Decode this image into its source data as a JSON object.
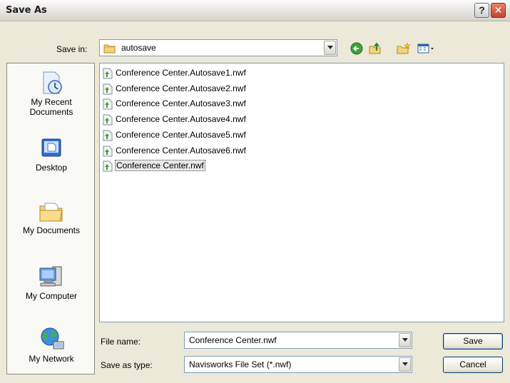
{
  "window": {
    "title": "Save As",
    "help_glyph": "?",
    "close_glyph": "✕"
  },
  "toolbar": {
    "save_in_label": "Save in:",
    "current_folder": "autosave",
    "back_icon": "back-arrow-icon",
    "up_icon": "up-folder-icon",
    "new_folder_icon": "new-folder-icon",
    "views_icon": "views-menu-icon"
  },
  "places": [
    {
      "label": "My Recent\nDocuments",
      "icon": "recent-documents-icon"
    },
    {
      "label": "Desktop",
      "icon": "desktop-icon"
    },
    {
      "label": "My Documents",
      "icon": "my-documents-icon"
    },
    {
      "label": "My Computer",
      "icon": "my-computer-icon"
    },
    {
      "label": "My Network",
      "icon": "my-network-icon"
    }
  ],
  "files": [
    {
      "name": "Conference Center.Autosave1.nwf",
      "selected": false
    },
    {
      "name": "Conference Center.Autosave2.nwf",
      "selected": false
    },
    {
      "name": "Conference Center.Autosave3.nwf",
      "selected": false
    },
    {
      "name": "Conference Center.Autosave4.nwf",
      "selected": false
    },
    {
      "name": "Conference Center.Autosave5.nwf",
      "selected": false
    },
    {
      "name": "Conference Center.Autosave6.nwf",
      "selected": false
    },
    {
      "name": "Conference Center.nwf",
      "selected": true
    }
  ],
  "form": {
    "file_name_label": "File name:",
    "file_name_value": "Conference Center.nwf",
    "save_type_label": "Save as type:",
    "save_type_value": "Navisworks File Set (*.nwf)"
  },
  "buttons": {
    "save": "Save",
    "cancel": "Cancel"
  },
  "colors": {
    "dialog_bg": "#ece9d8",
    "field_border": "#7f9db9",
    "button_border": "#003c74"
  }
}
